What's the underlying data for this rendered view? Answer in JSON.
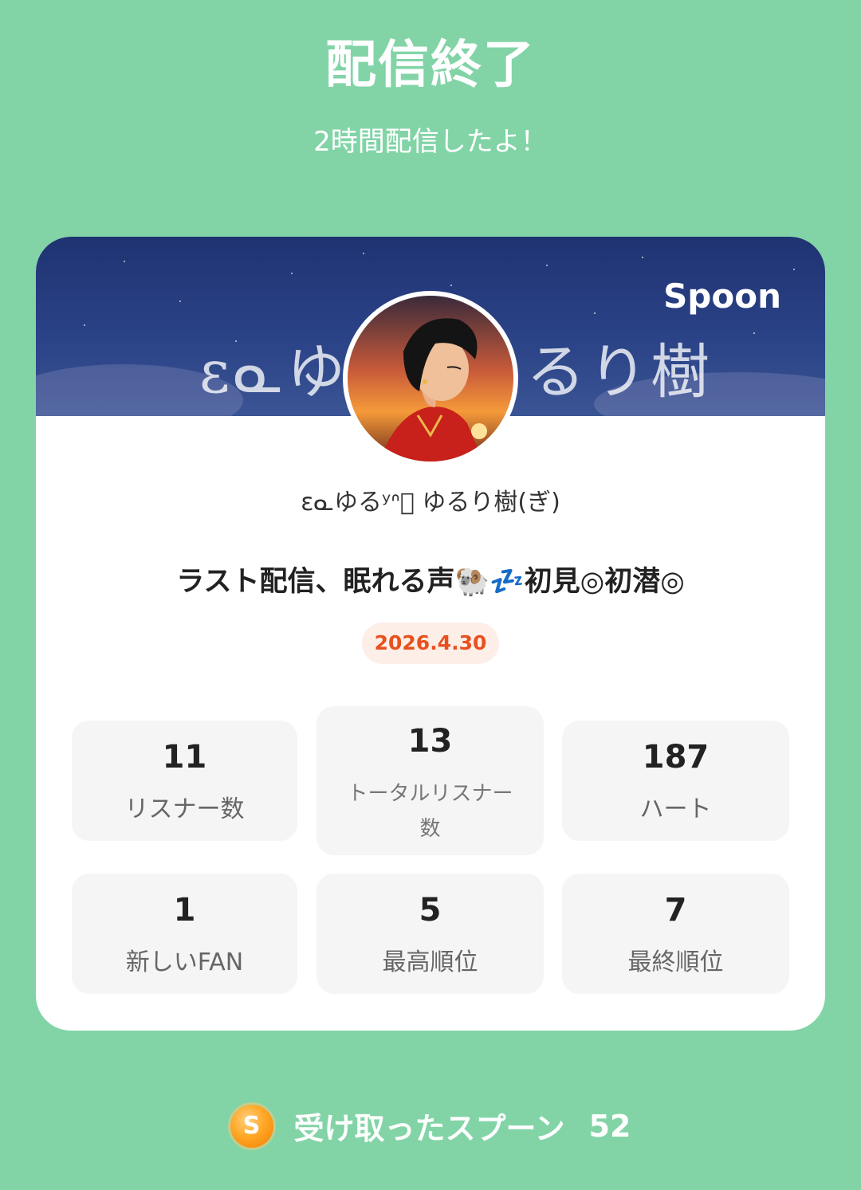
{
  "header": {
    "title": "配信終了",
    "subtitle": "2時間配信したよ！"
  },
  "banner": {
    "brand": "Spoon",
    "text_left": "ɛᓇゆる",
    "text_right": "るり樹",
    "avatar_icon": "profile-avatar"
  },
  "profile": {
    "name": "ɛᓇゆるʸᐢ゚ ゆるり樹(ぎ)"
  },
  "broadcast": {
    "title": "ラスト配信、眠れる声🐏💤初見◎初潜◎",
    "date": "2026.4.30"
  },
  "stats": [
    {
      "value": "11",
      "label": "リスナー数"
    },
    {
      "value": "13",
      "label": "トータルリスナー数"
    },
    {
      "value": "187",
      "label": "ハート"
    },
    {
      "value": "1",
      "label": "新しいFAN"
    },
    {
      "value": "5",
      "label": "最高順位"
    },
    {
      "value": "7",
      "label": "最終順位"
    }
  ],
  "footer": {
    "coin_icon": "spoon-coin-icon",
    "coin_letter": "S",
    "label": "受け取ったスプーン",
    "count": "52"
  },
  "colors": {
    "background": "#82d4a7",
    "date_accent": "#e8501e",
    "banner": "#1f3372"
  }
}
